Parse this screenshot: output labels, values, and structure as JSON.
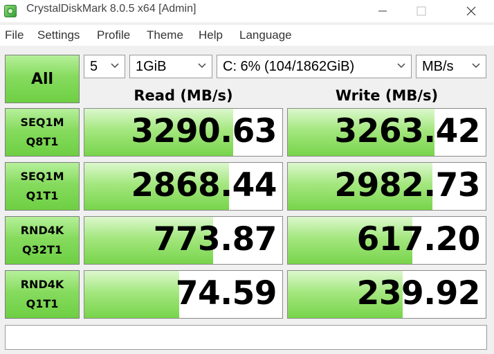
{
  "window": {
    "title": "CrystalDiskMark 8.0.5 x64 [Admin]",
    "icon": "crystaldiskmark-app-icon"
  },
  "menu": [
    "File",
    "Settings",
    "Profile",
    "Theme",
    "Help",
    "Language"
  ],
  "controls": {
    "all_label": "All",
    "count": "5",
    "size": "1GiB",
    "drive": "C: 6% (104/1862GiB)",
    "unit": "MB/s"
  },
  "headers": {
    "read": "Read (MB/s)",
    "write": "Write (MB/s)"
  },
  "tests": [
    {
      "line1": "SEQ1M",
      "line2": "Q8T1",
      "read": "3290.63",
      "write": "3263.42",
      "read_fill": 0.75,
      "write_fill": 0.74
    },
    {
      "line1": "SEQ1M",
      "line2": "Q1T1",
      "read": "2868.44",
      "write": "2982.73",
      "read_fill": 0.73,
      "write_fill": 0.73
    },
    {
      "line1": "RND4K",
      "line2": "Q32T1",
      "read": "773.87",
      "write": "617.20",
      "read_fill": 0.65,
      "write_fill": 0.63
    },
    {
      "line1": "RND4K",
      "line2": "Q1T1",
      "read": "74.59",
      "write": "239.92",
      "read_fill": 0.48,
      "write_fill": 0.58
    }
  ],
  "comment": "",
  "colors": {
    "accent_green": "#78d44b",
    "border": "#8a8a8a"
  }
}
